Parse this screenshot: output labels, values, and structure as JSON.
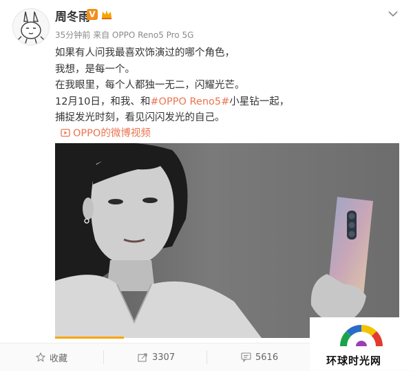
{
  "post": {
    "username": "周冬雨",
    "verified_badge": "V",
    "meta": "35分钟前 来自 OPPO Reno5 Pro 5G",
    "lines": [
      "如果有人问我最喜欢饰演过的哪个角色，",
      "我想，是每一个。",
      "在我眼里，每个人都独一无二，闪耀光芒。"
    ],
    "line4_prefix": "12月10日，和我、和",
    "line4_topic": "#OPPO Reno5#",
    "line4_suffix": "小星钻一起，",
    "line5": "捕捉发光时刻，看见闪闪发光的自己。",
    "video_link": "OPPO的微博视频",
    "video_progress": 0.2
  },
  "footer": {
    "favorite_label": "收藏",
    "repost_count": "3307",
    "comment_count": "5616"
  },
  "watermark": {
    "text": "环球时光网"
  },
  "colors": {
    "accent": "#eb7350",
    "verified": "#f28e1c",
    "progress": "#f7a500"
  }
}
